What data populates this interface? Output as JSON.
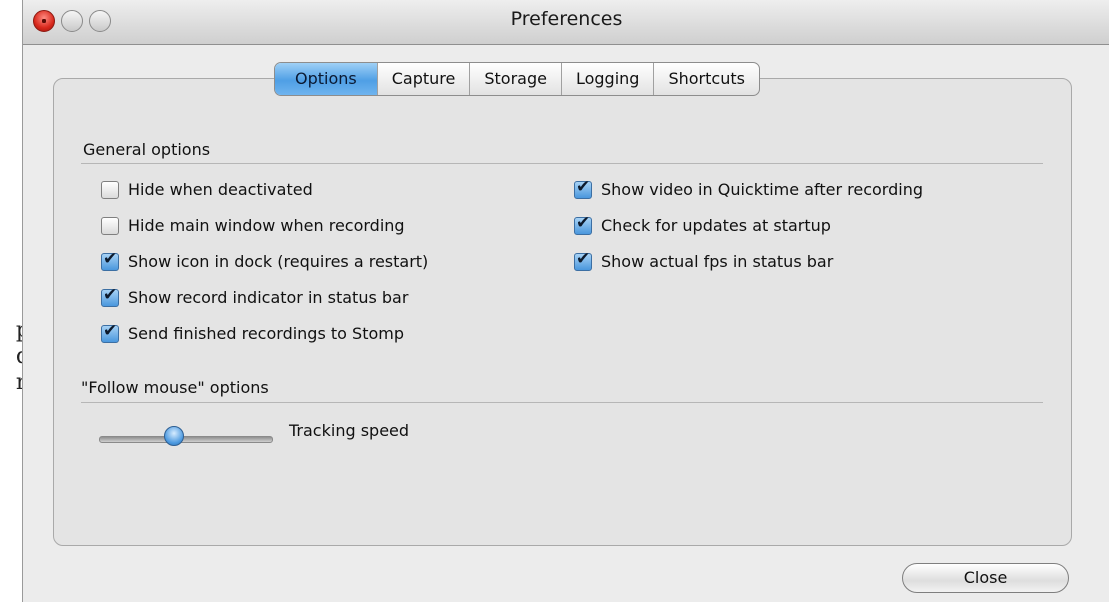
{
  "window": {
    "title": "Preferences"
  },
  "bleed_text": [
    "p",
    "d",
    "n"
  ],
  "tabs": [
    {
      "label": "Options",
      "active": true
    },
    {
      "label": "Capture",
      "active": false
    },
    {
      "label": "Storage",
      "active": false
    },
    {
      "label": "Logging",
      "active": false
    },
    {
      "label": "Shortcuts",
      "active": false
    }
  ],
  "general": {
    "heading": "General options",
    "left": [
      {
        "label": "Hide when deactivated",
        "checked": false
      },
      {
        "label": "Hide main window when recording",
        "checked": false
      },
      {
        "label": "Show icon in dock (requires a restart)",
        "checked": true
      },
      {
        "label": "Show record indicator in status bar",
        "checked": true
      },
      {
        "label": "Send finished recordings to Stomp",
        "checked": true
      }
    ],
    "right": [
      {
        "label": "Show video in Quicktime after recording",
        "checked": true
      },
      {
        "label": "Check for updates at startup",
        "checked": true
      },
      {
        "label": "Show actual fps in status bar",
        "checked": true
      }
    ]
  },
  "follow": {
    "heading": "\"Follow mouse\" options",
    "slider_label": "Tracking speed",
    "slider_value": 0.33
  },
  "footer": {
    "close_label": "Close"
  },
  "colors": {
    "accent": "#4f9fe5",
    "panel": "#e4e4e4",
    "window": "#ececec"
  }
}
